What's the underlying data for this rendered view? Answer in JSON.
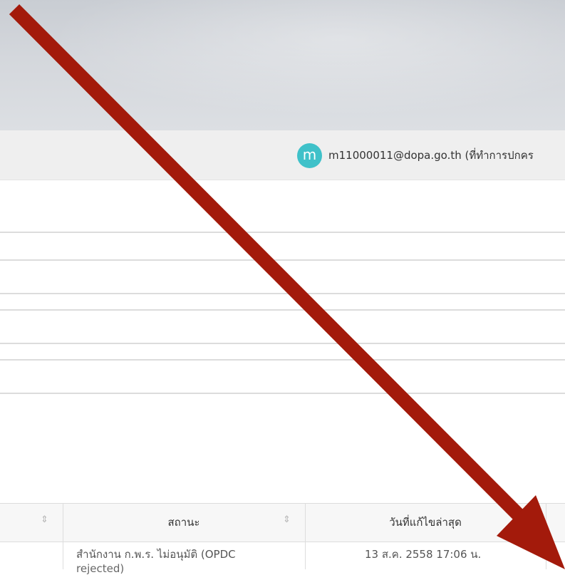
{
  "user": {
    "avatar_letter": "m",
    "email": "m11000011@dopa.go.th (ที่ทำการปกคร"
  },
  "table": {
    "columns": [
      {
        "label": "สถานะ"
      },
      {
        "label": "วันที่แก้ไขล่าสุด"
      }
    ],
    "rows": [
      {
        "status_line1": "สำนักงาน ก.พ.ร. ไม่อนุมัติ (OPDC",
        "status_line2": "rejected)",
        "updated": "13 ส.ค. 2558 17:06 น."
      }
    ]
  },
  "colors": {
    "avatar": "#3fc1c9",
    "annotation_arrow": "#a31a0b"
  },
  "icons": {
    "sort": "sort-updown-icon",
    "annotation": "red-arrow-annotation"
  }
}
